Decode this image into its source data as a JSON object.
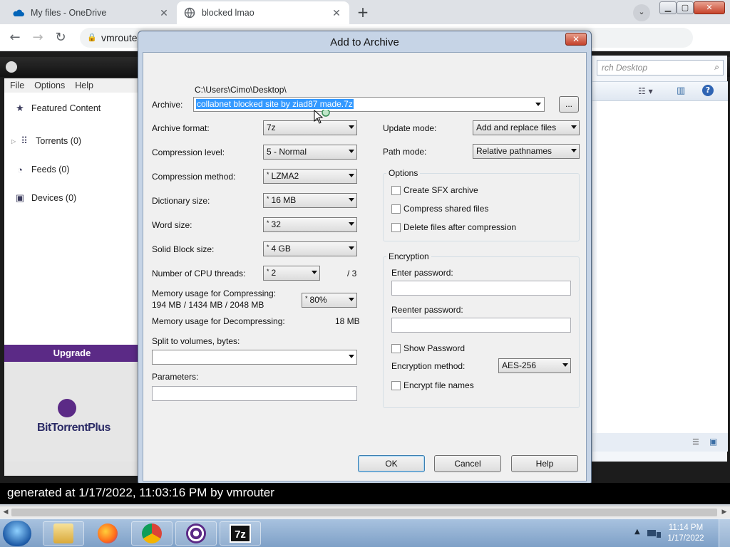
{
  "browser": {
    "tabs": [
      {
        "title": "My files - OneDrive",
        "active": false
      },
      {
        "title": "blocked lmao",
        "active": true
      }
    ],
    "address": "vmroute",
    "colors": {
      "onedrive": "#0364b8",
      "tab_bg": "#dee1e6"
    }
  },
  "bittorrent": {
    "menu": [
      "File",
      "Options",
      "Help"
    ],
    "sidebar": [
      {
        "label": "Featured Content",
        "icon": "star-icon"
      },
      {
        "label": "Torrents (0)",
        "icon": "torrents-icon"
      },
      {
        "label": "Feeds (0)",
        "icon": "rss-icon"
      },
      {
        "label": "Devices (0)",
        "icon": "device-icon"
      }
    ],
    "upgrade": "Upgrade",
    "plus_logo": "BitTorrentPlus",
    "accent": "#5b2a86"
  },
  "explorer": {
    "search_placeholder": "rch Desktop"
  },
  "dialog": {
    "title": "Add to Archive",
    "archive_label": "Archive:",
    "archive_path": "C:\\Users\\Cimo\\Desktop\\",
    "archive_name": "collabnet blocked site by ziad87 made.7z",
    "browse": "...",
    "fields": {
      "format": {
        "label": "Archive format:",
        "value": "7z"
      },
      "level": {
        "label": "Compression level:",
        "value": "5 - Normal"
      },
      "method": {
        "label": "Compression method:",
        "value": "LZMA2"
      },
      "dict": {
        "label": "Dictionary size:",
        "value": "16 MB"
      },
      "word": {
        "label": "Word size:",
        "value": "32"
      },
      "solid": {
        "label": "Solid Block size:",
        "value": "4 GB"
      },
      "threads": {
        "label": "Number of CPU threads:",
        "value": "2",
        "max": "/ 3"
      },
      "mem_comp": {
        "label": "Memory usage for Compressing:",
        "detail": "194 MB / 1434 MB / 2048 MB",
        "value": "80%"
      },
      "mem_decomp": {
        "label": "Memory usage for Decompressing:",
        "value": "18 MB"
      },
      "split": {
        "label": "Split to volumes, bytes:",
        "value": ""
      },
      "params": {
        "label": "Parameters:",
        "value": ""
      }
    },
    "update_mode": {
      "label": "Update mode:",
      "value": "Add and replace files"
    },
    "path_mode": {
      "label": "Path mode:",
      "value": "Relative pathnames"
    },
    "options": {
      "title": "Options",
      "items": [
        "Create SFX archive",
        "Compress shared files",
        "Delete files after compression"
      ]
    },
    "encryption": {
      "title": "Encryption",
      "enter_password": "Enter password:",
      "reenter_password": "Reenter password:",
      "show_password": "Show Password",
      "method_label": "Encryption method:",
      "method_value": "AES-256",
      "encrypt_names": "Encrypt file names"
    },
    "buttons": {
      "ok": "OK",
      "cancel": "Cancel",
      "help": "Help"
    }
  },
  "page_footer": "generated at 1/17/2022, 11:03:16 PM by vmrouter",
  "taskbar": {
    "apps": [
      "explorer-icon",
      "firefox-icon",
      "chrome-icon",
      "bittorrent-icon",
      "7zip-icon"
    ],
    "zip_label": "7z",
    "time": "11:14 PM",
    "date": "1/17/2022"
  }
}
